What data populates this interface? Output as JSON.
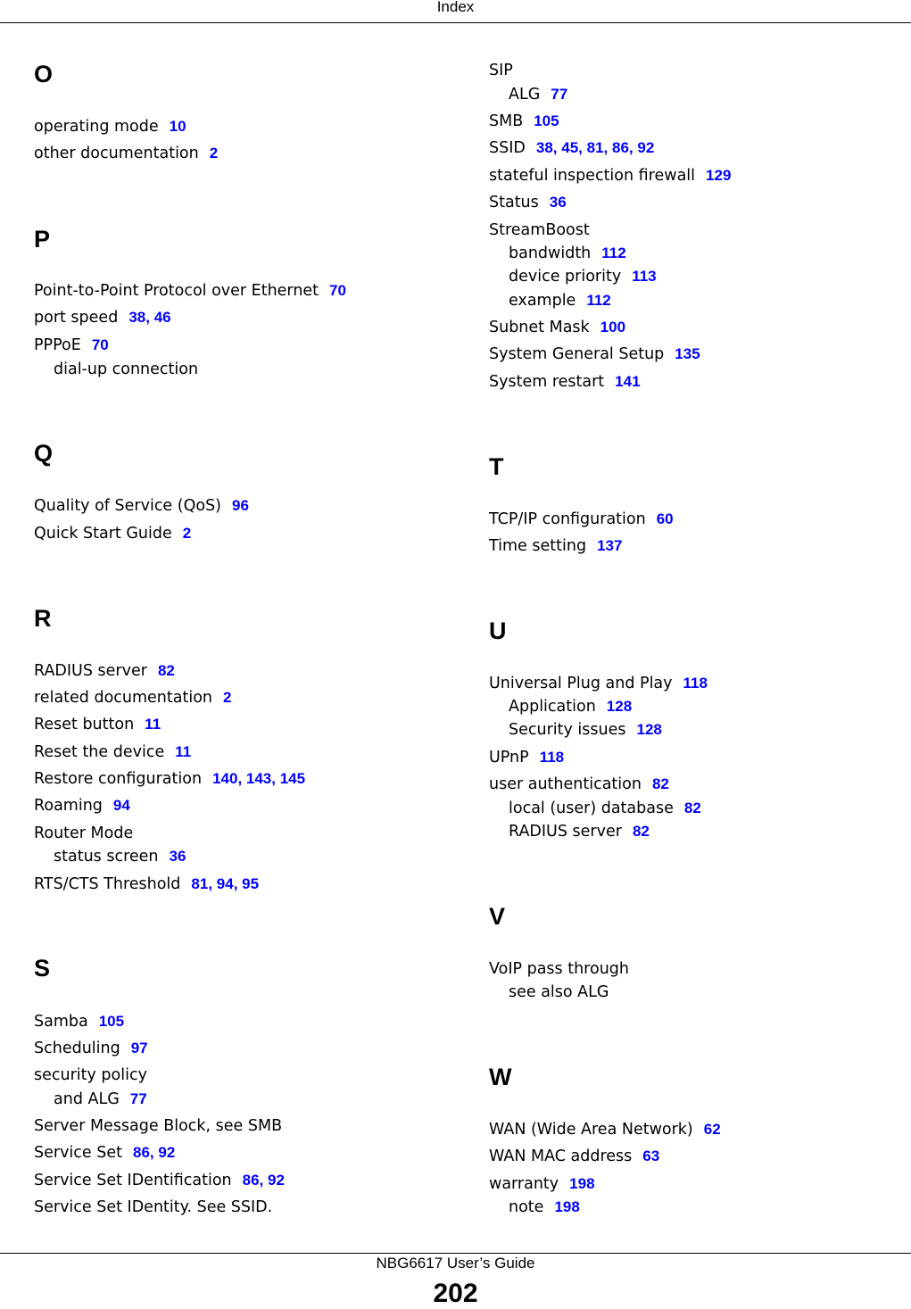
{
  "header": {
    "title": "Index"
  },
  "footer": {
    "guide": "NBG6617 User’s Guide",
    "page_number": "202"
  },
  "sections": [
    {
      "letter": "O",
      "entries": [
        {
          "term": "operating mode",
          "pages": [
            "10"
          ],
          "sub": false
        },
        {
          "term": "other documentation",
          "pages": [
            "2"
          ],
          "sub": false
        }
      ]
    },
    {
      "letter": "P",
      "entries": [
        {
          "term": "Point-to-Point Protocol over Ethernet",
          "pages": [
            "70"
          ],
          "sub": false
        },
        {
          "term": "port speed",
          "pages": [
            "38",
            "46"
          ],
          "sub": false
        },
        {
          "term": "PPPoE",
          "pages": [
            "70"
          ],
          "sub": false
        },
        {
          "term": "dial-up connection",
          "pages": [],
          "sub": true
        }
      ]
    },
    {
      "letter": "Q",
      "entries": [
        {
          "term": "Quality of Service (QoS)",
          "pages": [
            "96"
          ],
          "sub": false
        },
        {
          "term": "Quick Start Guide",
          "pages": [
            "2"
          ],
          "sub": false
        }
      ]
    },
    {
      "letter": "R",
      "entries": [
        {
          "term": "RADIUS server",
          "pages": [
            "82"
          ],
          "sub": false
        },
        {
          "term": "related documentation",
          "pages": [
            "2"
          ],
          "sub": false
        },
        {
          "term": "Reset button",
          "pages": [
            "11"
          ],
          "sub": false
        },
        {
          "term": "Reset the device",
          "pages": [
            "11"
          ],
          "sub": false
        },
        {
          "term": "Restore configuration",
          "pages": [
            "140",
            "143",
            "145"
          ],
          "sub": false
        },
        {
          "term": "Roaming",
          "pages": [
            "94"
          ],
          "sub": false
        },
        {
          "term": "Router Mode",
          "pages": [],
          "sub": false
        },
        {
          "term": "status screen",
          "pages": [
            "36"
          ],
          "sub": true
        },
        {
          "term": "RTS/CTS Threshold",
          "pages": [
            "81",
            "94",
            "95"
          ],
          "sub": false
        }
      ]
    },
    {
      "letter": "S",
      "entries": [
        {
          "term": "Samba",
          "pages": [
            "105"
          ],
          "sub": false
        },
        {
          "term": "Scheduling",
          "pages": [
            "97"
          ],
          "sub": false
        },
        {
          "term": "security policy",
          "pages": [],
          "sub": false
        },
        {
          "term": "and ALG",
          "pages": [
            "77"
          ],
          "sub": true
        },
        {
          "term": "Server Message Block, see SMB",
          "pages": [],
          "sub": false
        },
        {
          "term": "Service Set",
          "pages": [
            "86",
            "92"
          ],
          "sub": false
        },
        {
          "term": "Service Set IDentification",
          "pages": [
            "86",
            "92"
          ],
          "sub": false
        },
        {
          "term": "Service Set IDentity. See SSID.",
          "pages": [],
          "sub": false
        },
        {
          "term": "SIP",
          "pages": [],
          "sub": false
        },
        {
          "term": "ALG",
          "pages": [
            "77"
          ],
          "sub": true
        },
        {
          "term": "SMB",
          "pages": [
            "105"
          ],
          "sub": false
        },
        {
          "term": "SSID",
          "pages": [
            "38",
            "45",
            "81",
            "86",
            "92"
          ],
          "sub": false
        },
        {
          "term": "stateful inspection firewall",
          "pages": [
            "129"
          ],
          "sub": false
        },
        {
          "term": "Status",
          "pages": [
            "36"
          ],
          "sub": false
        },
        {
          "term": "StreamBoost",
          "pages": [],
          "sub": false
        },
        {
          "term": "bandwidth",
          "pages": [
            "112"
          ],
          "sub": true
        },
        {
          "term": "device priority",
          "pages": [
            "113"
          ],
          "sub": true
        },
        {
          "term": "example",
          "pages": [
            "112"
          ],
          "sub": true
        },
        {
          "term": "Subnet Mask",
          "pages": [
            "100"
          ],
          "sub": false
        },
        {
          "term": "System General Setup",
          "pages": [
            "135"
          ],
          "sub": false
        },
        {
          "term": "System restart",
          "pages": [
            "141"
          ],
          "sub": false
        }
      ]
    },
    {
      "letter": "T",
      "entries": [
        {
          "term": "TCP/IP configuration",
          "pages": [
            "60"
          ],
          "sub": false
        },
        {
          "term": "Time setting",
          "pages": [
            "137"
          ],
          "sub": false
        }
      ]
    },
    {
      "letter": "U",
      "entries": [
        {
          "term": "Universal Plug and Play",
          "pages": [
            "118"
          ],
          "sub": false
        },
        {
          "term": "Application",
          "pages": [
            "128"
          ],
          "sub": true
        },
        {
          "term": "Security issues",
          "pages": [
            "128"
          ],
          "sub": true
        },
        {
          "term": "UPnP",
          "pages": [
            "118"
          ],
          "sub": false
        },
        {
          "term": "user authentication",
          "pages": [
            "82"
          ],
          "sub": false
        },
        {
          "term": "local (user) database",
          "pages": [
            "82"
          ],
          "sub": true
        },
        {
          "term": "RADIUS server",
          "pages": [
            "82"
          ],
          "sub": true
        }
      ]
    },
    {
      "letter": "V",
      "entries": [
        {
          "term": "VoIP pass through",
          "pages": [],
          "sub": false
        },
        {
          "term": "see also ALG",
          "pages": [],
          "sub": true
        }
      ]
    },
    {
      "letter": "W",
      "entries": [
        {
          "term": "WAN (Wide Area Network)",
          "pages": [
            "62"
          ],
          "sub": false
        },
        {
          "term": "WAN MAC address",
          "pages": [
            "63"
          ],
          "sub": false
        },
        {
          "term": "warranty",
          "pages": [
            "198"
          ],
          "sub": false
        },
        {
          "term": "note",
          "pages": [
            "198"
          ],
          "sub": true
        }
      ]
    }
  ]
}
